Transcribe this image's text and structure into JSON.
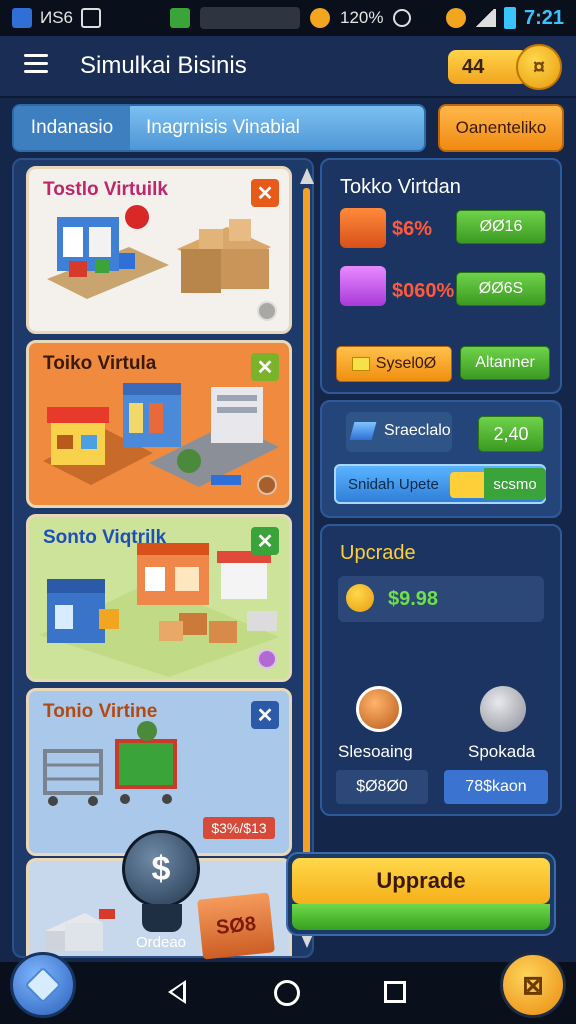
{
  "status_bar": {
    "left_text": "ИS6",
    "mid_text": "120%",
    "time": "7:21"
  },
  "header": {
    "title": "Simulkai Bisinis",
    "coins": "44"
  },
  "tabs": {
    "tab_a": "Indanasio",
    "tab_b": "Inagrnisis Vinabial",
    "action_button": "Oanenteliko"
  },
  "cards": [
    {
      "title": "Tostlo Virtuilk",
      "close": "✕",
      "color_bg": "#f4f1ec",
      "title_color": "#c0256b"
    },
    {
      "title": "Toiko Virtula",
      "close": "✕",
      "color_bg": "#f08a3e",
      "title_color": "#3b1a0a"
    },
    {
      "title": "Sonto Viqtrilk",
      "close": "✕",
      "color_bg": "#cde39a",
      "title_color": "#1e4fb8"
    },
    {
      "title": "Tonio Virtine",
      "close": "✕",
      "price": "$3%/$13",
      "color_bg": "#a9c8ea",
      "title_color": "#b04a12"
    }
  ],
  "store_panel": {
    "title": "Tokko Virtdan",
    "stat1_value": "$6%",
    "stat1_button": "ØØ16",
    "stat2_value": "$060%",
    "stat2_button": "ØØ6S",
    "system_button": "Sysel0Ø",
    "attention_button": "Altanner"
  },
  "boost_panel": {
    "label": "Sraeclalo",
    "value": "2,40",
    "upgrade_label": "Snidah Upete",
    "upgrade_value": "scsmo"
  },
  "upgrade_panel": {
    "title": "Upcrade",
    "money": "$9.98",
    "skill1": "Slesoaing",
    "skill2": "Spokada",
    "skill1_value": "$Ø8Ø0",
    "skill2_value": "78$kaon"
  },
  "big_button": "Upprade",
  "order_widget": {
    "label": "Ordeao",
    "box_text": "SØ8"
  }
}
